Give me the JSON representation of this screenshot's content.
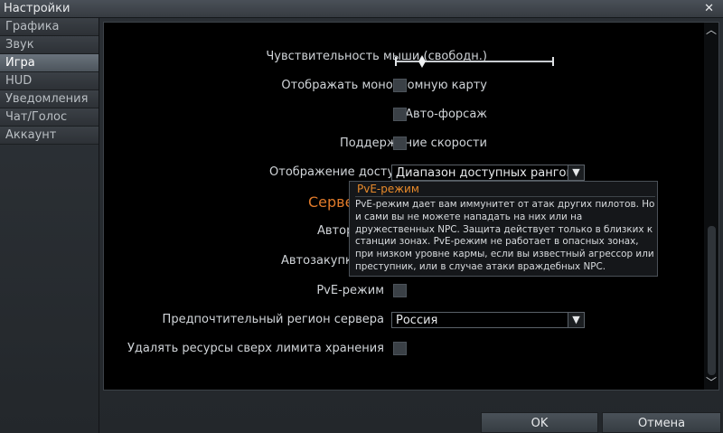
{
  "window": {
    "title": "Настройки",
    "close_glyph": "✕"
  },
  "sidebar": {
    "items": [
      {
        "label": "Графика",
        "active": false
      },
      {
        "label": "Звук",
        "active": false
      },
      {
        "label": "Игра",
        "active": true
      },
      {
        "label": "HUD",
        "active": false
      },
      {
        "label": "Уведомления",
        "active": false
      },
      {
        "label": "Чат/Голос",
        "active": false
      },
      {
        "label": "Аккаунт",
        "active": false
      }
    ]
  },
  "settings": {
    "mouse_sensitivity": {
      "label": "Чувствительность мыши (свободн.)",
      "value": 0.17
    },
    "monochrome_map": {
      "label": "Отображать монохромную карту",
      "checked": false
    },
    "auto_boost": {
      "label": "Авто-форсаж",
      "checked": false
    },
    "speed_hold": {
      "label": "Поддержание скорости",
      "checked": false
    },
    "module_availability": {
      "label": "Отображение доступности модуля",
      "value": "Диапазон доступных рангов"
    },
    "section_title_partial": "Серве",
    "partial_label_1": "Автор",
    "partial_label_2": "Автозакупка бое",
    "pve_mode": {
      "label": "PvE-режим",
      "checked": false
    },
    "server_region": {
      "label": "Предпочтительный регион сервера",
      "value": "Россия"
    },
    "delete_resources": {
      "label": "Удалять ресурсы сверх лимита хранения",
      "checked": false
    }
  },
  "tooltip": {
    "title": "PvE-режим",
    "body": "PvE-режим дает вам иммунитет от атак других пилотов. Но и сами вы не можете нападать на них или на дружественных NPC. Защита действует только в близких к станции зонах. PvE-режим не работает в опасных зонах, при низком уровне кармы, если вы известный агрессор или преступник, или в случае атаки враждебных NPC."
  },
  "buttons": {
    "ok": "OK",
    "cancel": "Отмена"
  },
  "icons": {
    "scroll_up": "chevron-up-icon",
    "scroll_down": "chevron-down-icon",
    "dropdown": "chevron-down-icon"
  },
  "colors": {
    "accent_orange": "#e07a2a",
    "tooltip_title": "#e88a2a"
  }
}
